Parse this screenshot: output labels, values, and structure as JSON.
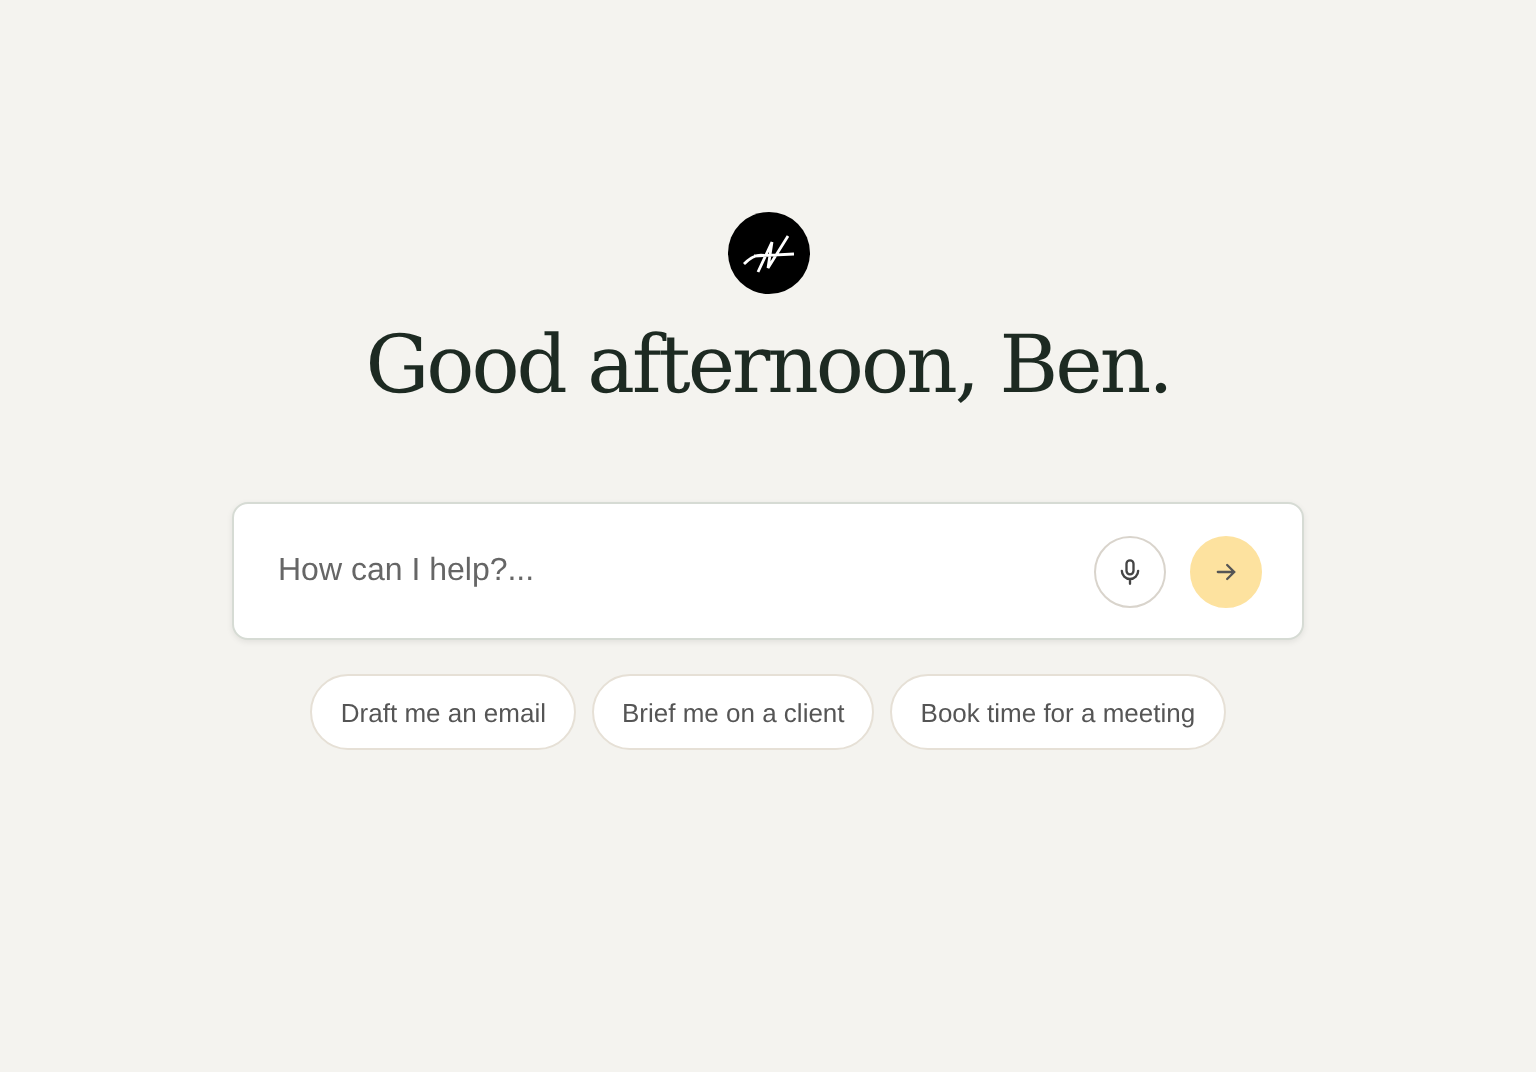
{
  "greeting": "Good afternoon, Ben.",
  "prompt": {
    "placeholder": "How can I help?..."
  },
  "suggestions": [
    "Draft me an email",
    "Brief me on a client",
    "Book time for a meeting"
  ]
}
